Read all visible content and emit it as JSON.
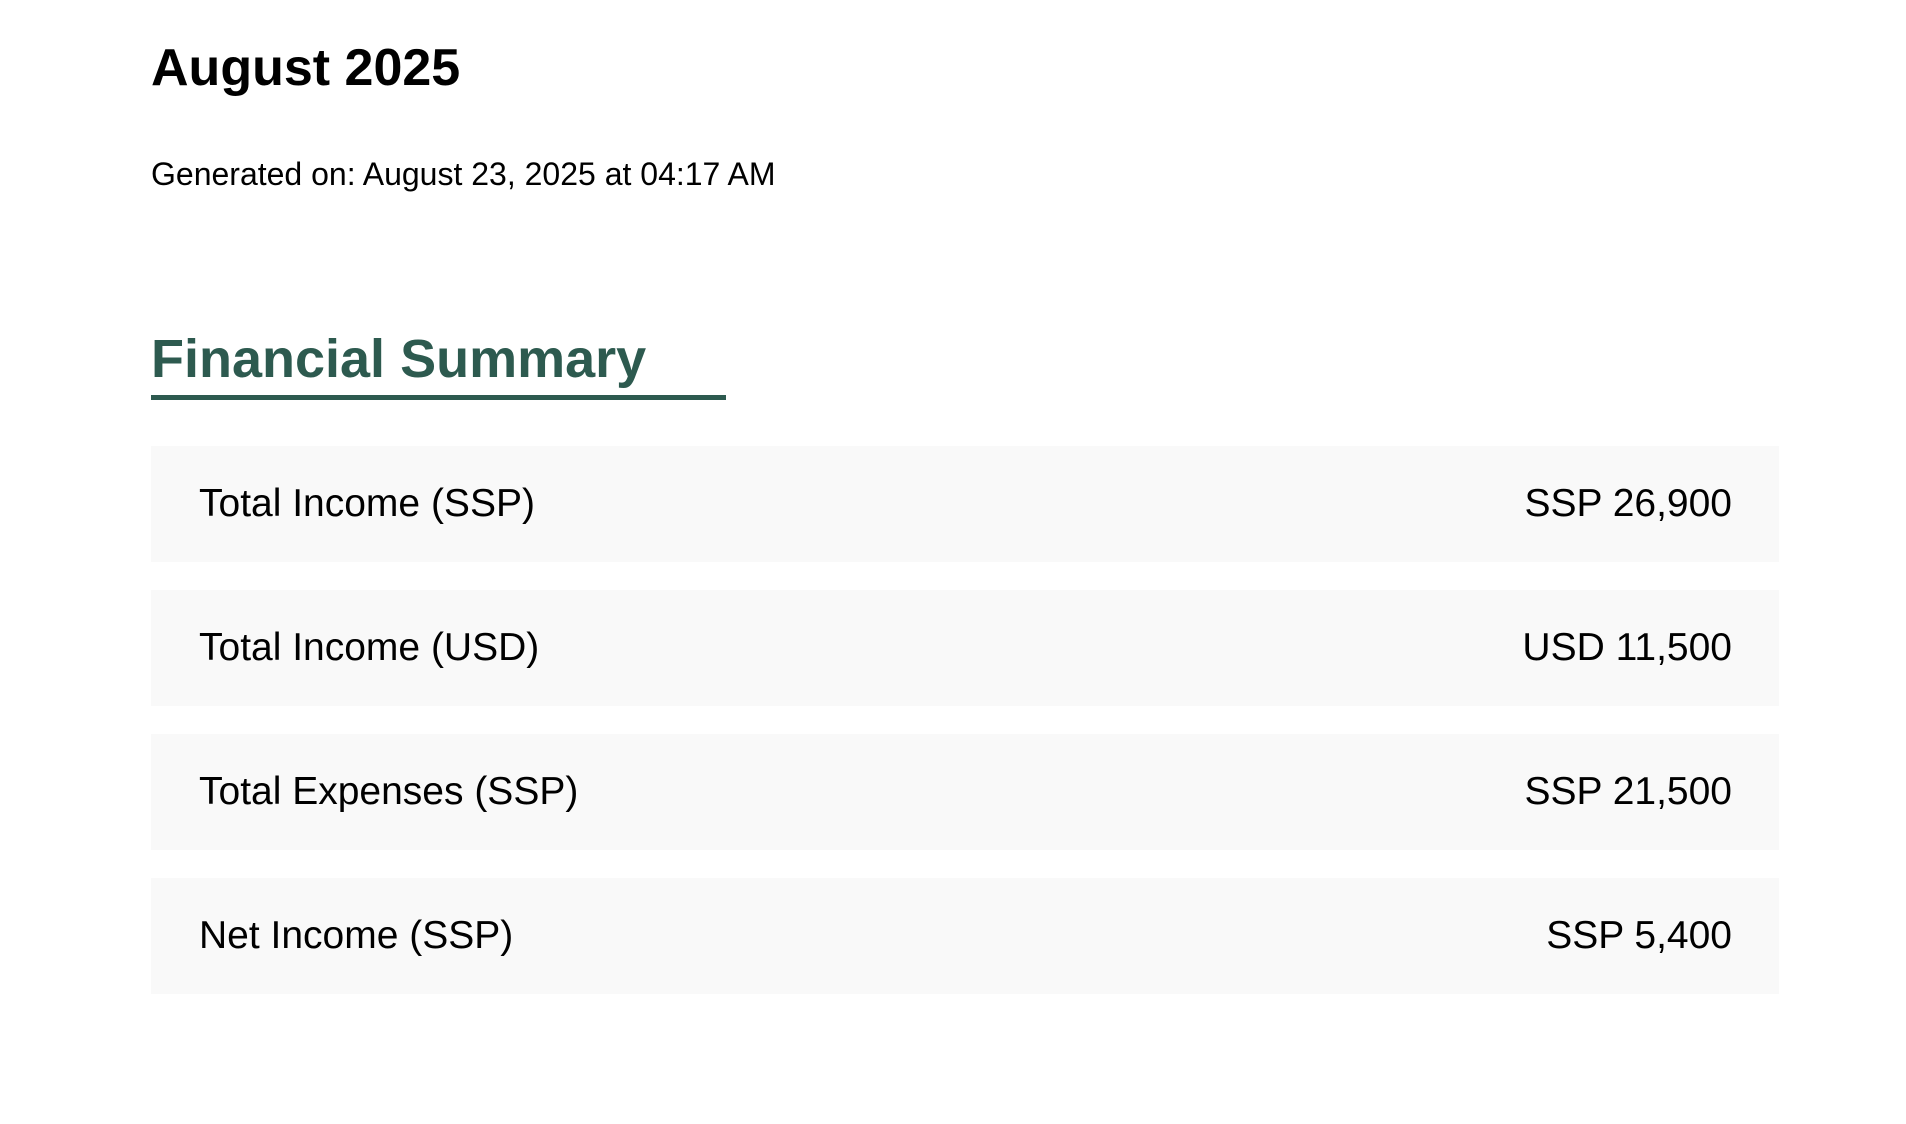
{
  "report": {
    "title": "August 2025",
    "generated": "Generated on: August 23, 2025 at 04:17 AM"
  },
  "summary": {
    "heading": "Financial Summary",
    "accent_color": "#2d5a4f",
    "rows": [
      {
        "label": "Total Income (SSP)",
        "value": "SSP 26,900"
      },
      {
        "label": "Total Income (USD)",
        "value": "USD 11,500"
      },
      {
        "label": "Total Expenses (SSP)",
        "value": "SSP 21,500"
      },
      {
        "label": "Net Income (SSP)",
        "value": "SSP 5,400"
      }
    ]
  }
}
